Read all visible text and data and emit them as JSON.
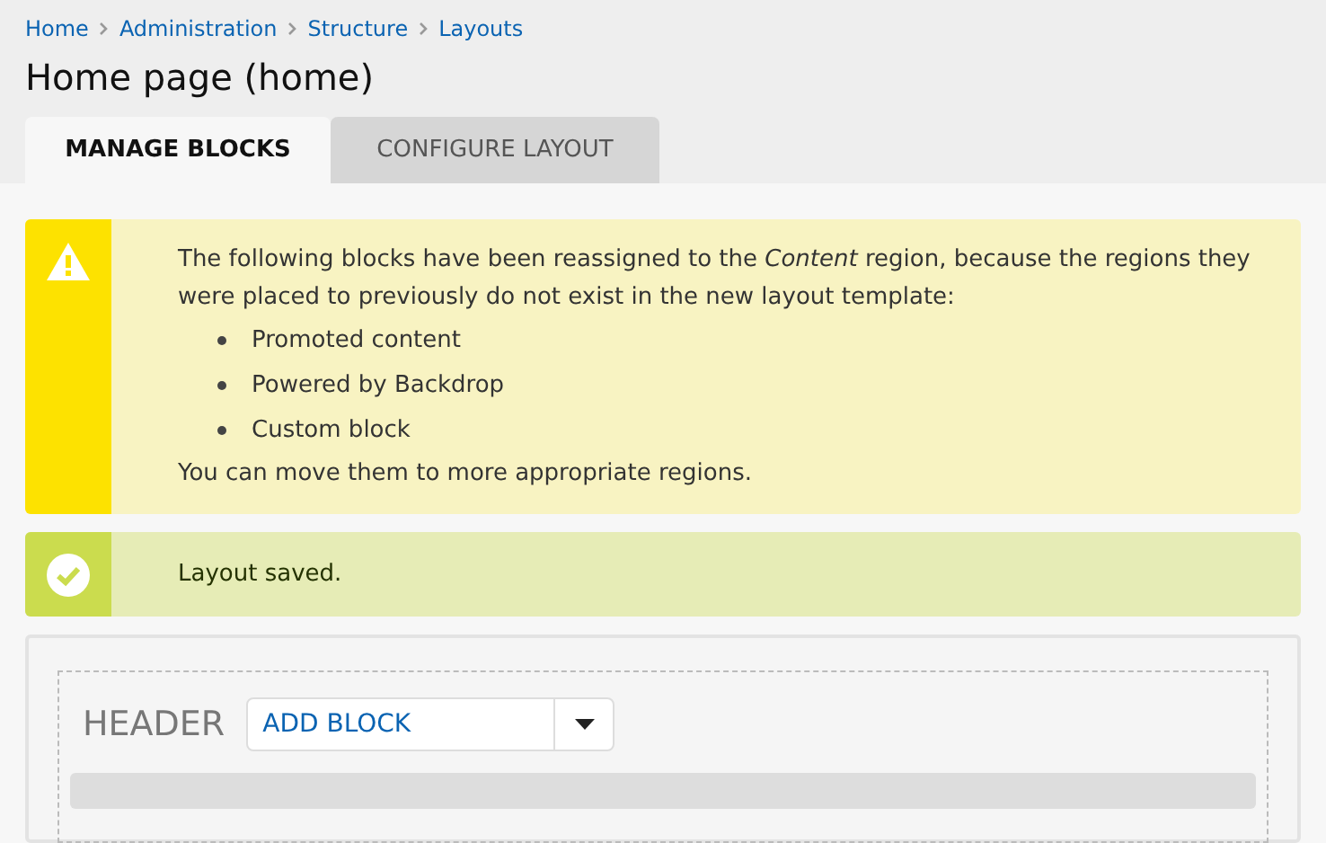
{
  "breadcrumb": [
    "Home",
    "Administration",
    "Structure",
    "Layouts"
  ],
  "title": "Home page (home)",
  "tabs": [
    {
      "label": "MANAGE BLOCKS",
      "selected": true
    },
    {
      "label": "CONFIGURE LAYOUT",
      "selected": false
    }
  ],
  "messages": [
    {
      "kind": "warning",
      "text": "The following blocks have been reassigned to the *Content* region, because the regions they were placed to previously do not exist in the new layout template:",
      "items": [
        "Promoted content",
        "Powered by Backdrop",
        "Custom block"
      ],
      "footer": "You can move them to more appropriate regions."
    },
    {
      "kind": "status",
      "text": "Layout saved."
    }
  ],
  "region": {
    "title": "HEADER",
    "add_button": "ADD BLOCK"
  }
}
